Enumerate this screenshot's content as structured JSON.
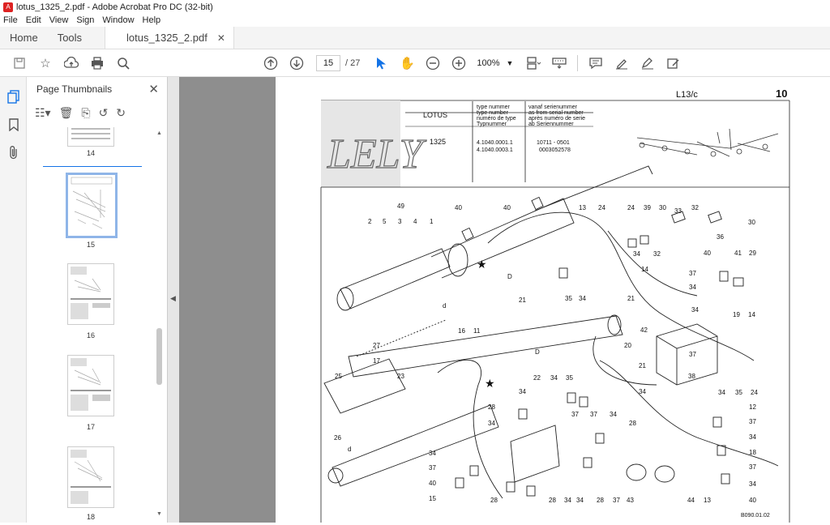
{
  "window": {
    "title": "lotus_1325_2.pdf - Adobe Acrobat Pro DC (32-bit)"
  },
  "menu": [
    "File",
    "Edit",
    "View",
    "Sign",
    "Window",
    "Help"
  ],
  "tabs": {
    "home": "Home",
    "tools": "Tools",
    "document": "lotus_1325_2.pdf"
  },
  "toolbar": {
    "current_page": "15",
    "total_pages": "/ 27",
    "zoom": "100%"
  },
  "thumb_panel": {
    "title": "Page Thumbnails",
    "pages": [
      "14",
      "15",
      "16",
      "17",
      "18"
    ],
    "selected_page": "15"
  },
  "pdf": {
    "page_ref": "L13/c",
    "page_no": "10",
    "logo": "LELY",
    "header_model_label": "LOTUS",
    "model": "1325",
    "type_number_labels": [
      "type nummer",
      "type number",
      "numéro de type",
      "Typnummer"
    ],
    "serial_labels": [
      "vanaf serienummer",
      "as from serial number",
      "après numéro de serie",
      "ab Seriennummer"
    ],
    "type_numbers": [
      "4.1040.0001.1",
      "4.1040.0003.1"
    ],
    "serial_numbers": [
      "10711 - 0501",
      "0003052578"
    ],
    "drawing_code": "B090.01.02",
    "callouts": [
      {
        "t": "49"
      },
      {
        "t": "2"
      },
      {
        "t": "5"
      },
      {
        "t": "3"
      },
      {
        "t": "4"
      },
      {
        "t": "1"
      },
      {
        "t": "40"
      },
      {
        "t": "40"
      },
      {
        "t": "13"
      },
      {
        "t": "24"
      },
      {
        "t": "24"
      },
      {
        "t": "39"
      },
      {
        "t": "30"
      },
      {
        "t": "33"
      },
      {
        "t": "32"
      },
      {
        "t": "30"
      },
      {
        "t": "36"
      },
      {
        "t": "34"
      },
      {
        "t": "32"
      },
      {
        "t": "14"
      },
      {
        "t": "40"
      },
      {
        "t": "41"
      },
      {
        "t": "29"
      },
      {
        "t": "37"
      },
      {
        "t": "34"
      },
      {
        "t": "19"
      },
      {
        "t": "14"
      },
      {
        "t": "D"
      },
      {
        "t": "D"
      },
      {
        "t": "d"
      },
      {
        "t": "d"
      },
      {
        "t": "21"
      },
      {
        "t": "35"
      },
      {
        "t": "34"
      },
      {
        "t": "21"
      },
      {
        "t": "34"
      },
      {
        "t": "42"
      },
      {
        "t": "20"
      },
      {
        "t": "21"
      },
      {
        "t": "37"
      },
      {
        "t": "38"
      },
      {
        "t": "34"
      },
      {
        "t": "34"
      },
      {
        "t": "35"
      },
      {
        "t": "24"
      },
      {
        "t": "27"
      },
      {
        "t": "17"
      },
      {
        "t": "16"
      },
      {
        "t": "11"
      },
      {
        "t": "25"
      },
      {
        "t": "23"
      },
      {
        "t": "22"
      },
      {
        "t": "34"
      },
      {
        "t": "35"
      },
      {
        "t": "12"
      },
      {
        "t": "37"
      },
      {
        "t": "34"
      },
      {
        "t": "28"
      },
      {
        "t": "34"
      },
      {
        "t": "34"
      },
      {
        "t": "37"
      },
      {
        "t": "37"
      },
      {
        "t": "34"
      },
      {
        "t": "28"
      },
      {
        "t": "18"
      },
      {
        "t": "26"
      },
      {
        "t": "34"
      },
      {
        "t": "37"
      },
      {
        "t": "40"
      },
      {
        "t": "15"
      },
      {
        "t": "28"
      },
      {
        "t": "28"
      },
      {
        "t": "34"
      },
      {
        "t": "34"
      },
      {
        "t": "28"
      },
      {
        "t": "37"
      },
      {
        "t": "43"
      },
      {
        "t": "44"
      },
      {
        "t": "13"
      },
      {
        "t": "37"
      },
      {
        "t": "40"
      },
      {
        "t": "34"
      }
    ]
  }
}
